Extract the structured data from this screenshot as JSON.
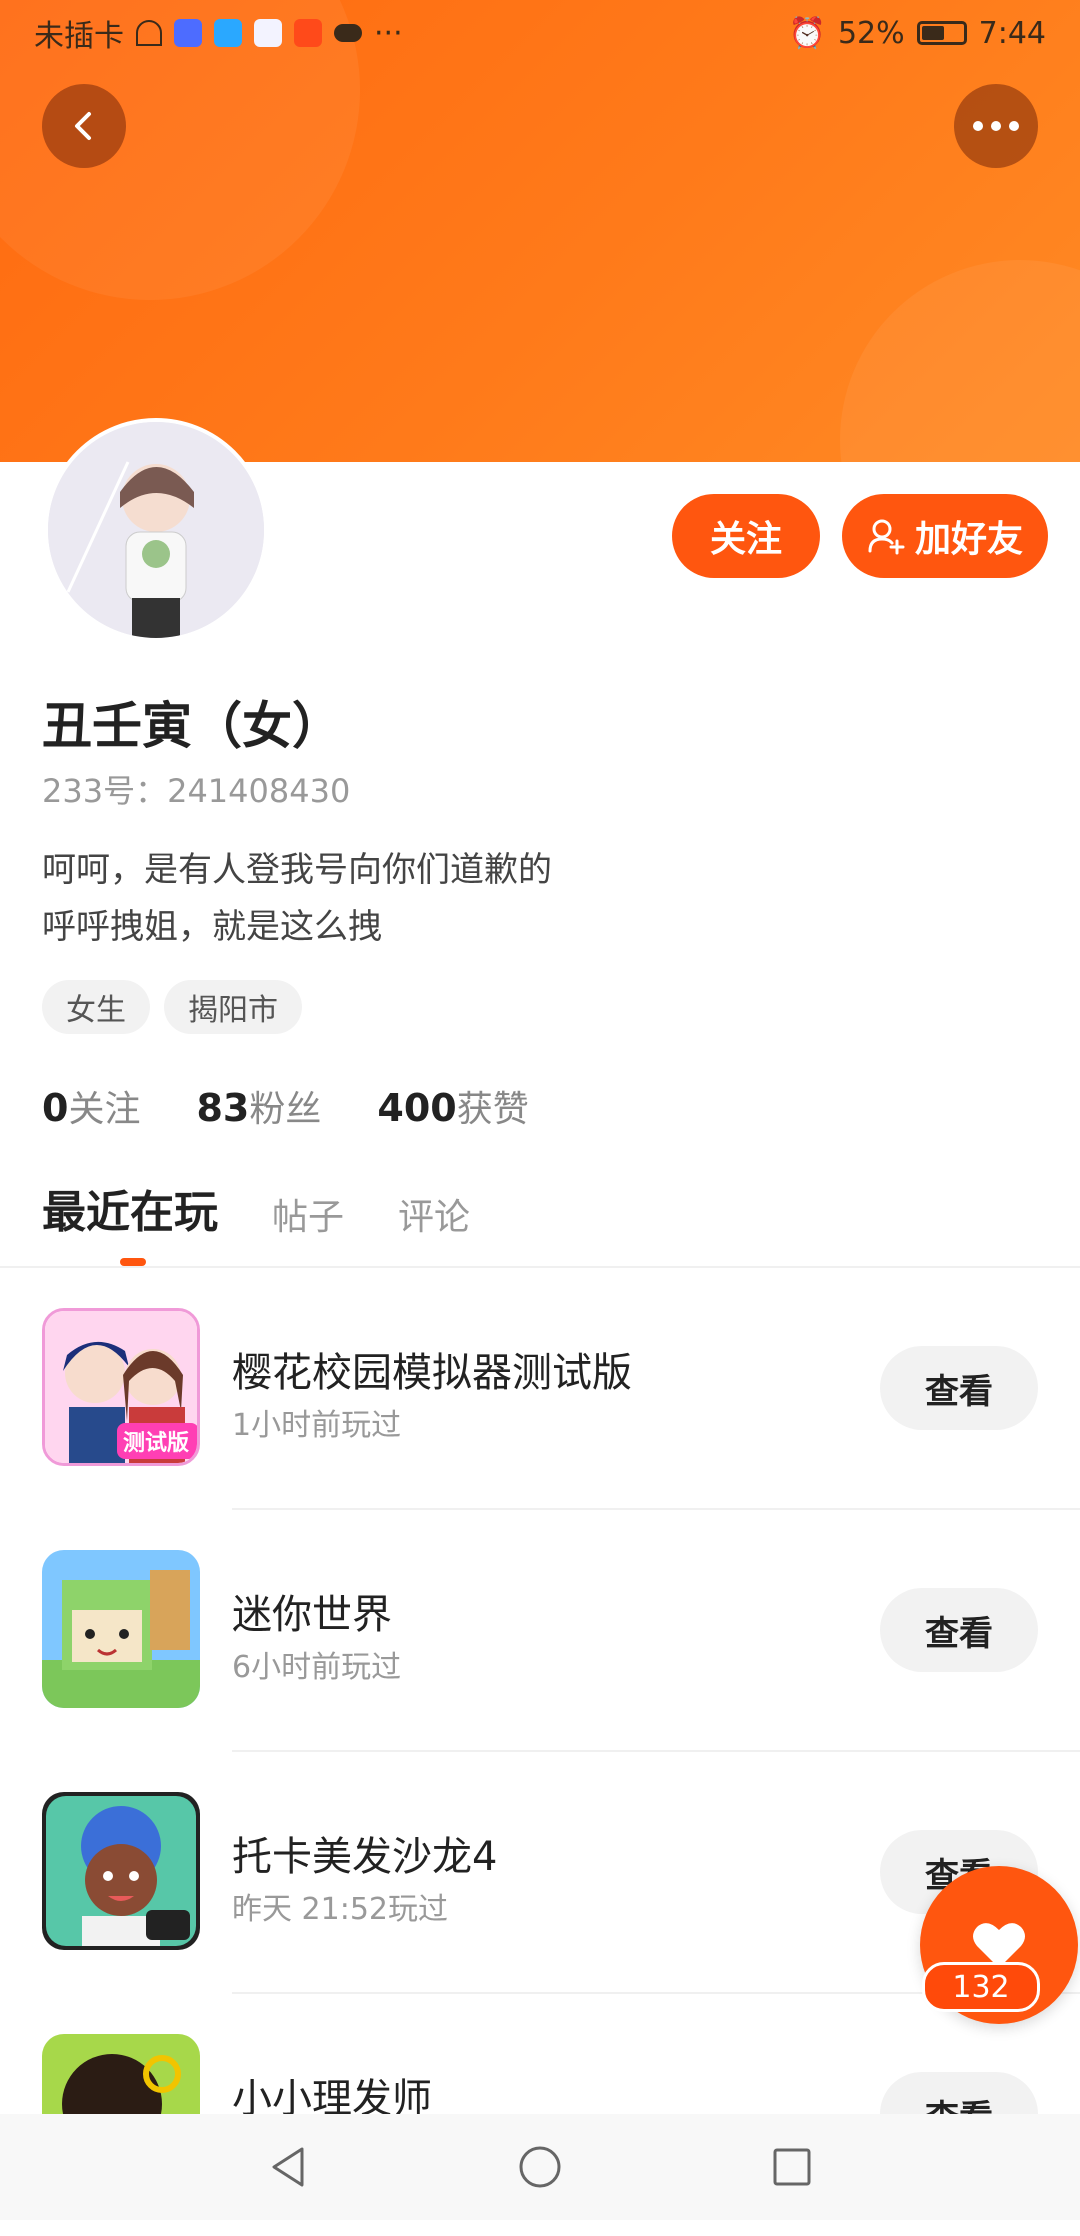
{
  "status_bar": {
    "carrier": "未插卡",
    "battery": "52%",
    "time": "7:44"
  },
  "header": {
    "back_icon": "chevron-left-icon",
    "more_icon": "more-horizontal-icon",
    "accent_color": "#ff560f"
  },
  "actions": {
    "follow_label": "关注",
    "add_friend_label": "加好友"
  },
  "profile": {
    "name": "丑壬寅（女）",
    "uid": "233号：241408430",
    "bio_line1": "呵呵，是有人登我号向你们道歉的",
    "bio_line2": "呼呼拽姐，就是这么拽",
    "tags": [
      "女生",
      "揭阳市"
    ],
    "stats": {
      "following_count": "0",
      "following_label": "关注",
      "fans_count": "83",
      "fans_label": "粉丝",
      "likes_count": "400",
      "likes_label": "获赞"
    }
  },
  "tabs": [
    "最近在玩",
    "帖子",
    "评论"
  ],
  "games": [
    {
      "title": "樱花校园模拟器测试版",
      "subtitle": "1小时前玩过",
      "button": "查看",
      "icon_badge": "测试版"
    },
    {
      "title": "迷你世界",
      "subtitle": "6小时前玩过",
      "button": "查看"
    },
    {
      "title": "托卡美发沙龙4",
      "subtitle": "昨天 21:52玩过",
      "button": "查看"
    },
    {
      "title": "小小理发师",
      "subtitle": "",
      "button": "查看"
    }
  ],
  "like_fab": {
    "count": "132"
  }
}
